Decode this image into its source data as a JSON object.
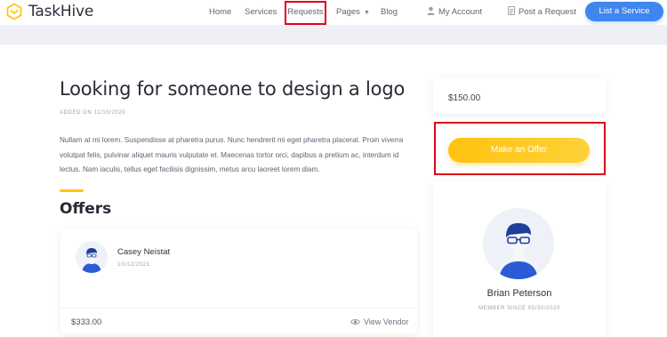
{
  "brand": {
    "name": "TaskHive",
    "accent": "#ffc512",
    "primary": "#3f86ee",
    "highlight": "#e0001b"
  },
  "nav": {
    "home": "Home",
    "services": "Services",
    "requests": "Requests",
    "pages": "Pages",
    "blog": "Blog",
    "account": "My Account",
    "post_request": "Post a Request",
    "cta": "List a Service"
  },
  "request": {
    "title": "Looking for someone to design a logo",
    "added": "ADDED ON 11/10/2020",
    "description": "Nullam at mi lorem. Suspendisse at pharetra purus. Nunc hendrerit mi eget pharetra placerat. Proin viverra volutpat felis, pulvinar aliquet mauris vulputate et. Maecenas tortor orci, dapibus a pretium ac, interdum id lectus. Nam iaculis, tellus eget facilisis dignissim, metus arcu laoreet lorem diam.",
    "budget": "$150.00",
    "offer_button": "Make an Offer"
  },
  "offers": {
    "heading": "Offers",
    "items": [
      {
        "name": "Casey Neistat",
        "date": "10/12/2021",
        "price": "$333.00",
        "action": "View Vendor"
      }
    ]
  },
  "vendor": {
    "name": "Brian Peterson",
    "member_since": "MEMBER SINCE 05/30/2020"
  },
  "icons": [
    "hexagon-logo-icon",
    "user-icon",
    "document-icon",
    "chevron-down-icon",
    "eye-icon"
  ]
}
